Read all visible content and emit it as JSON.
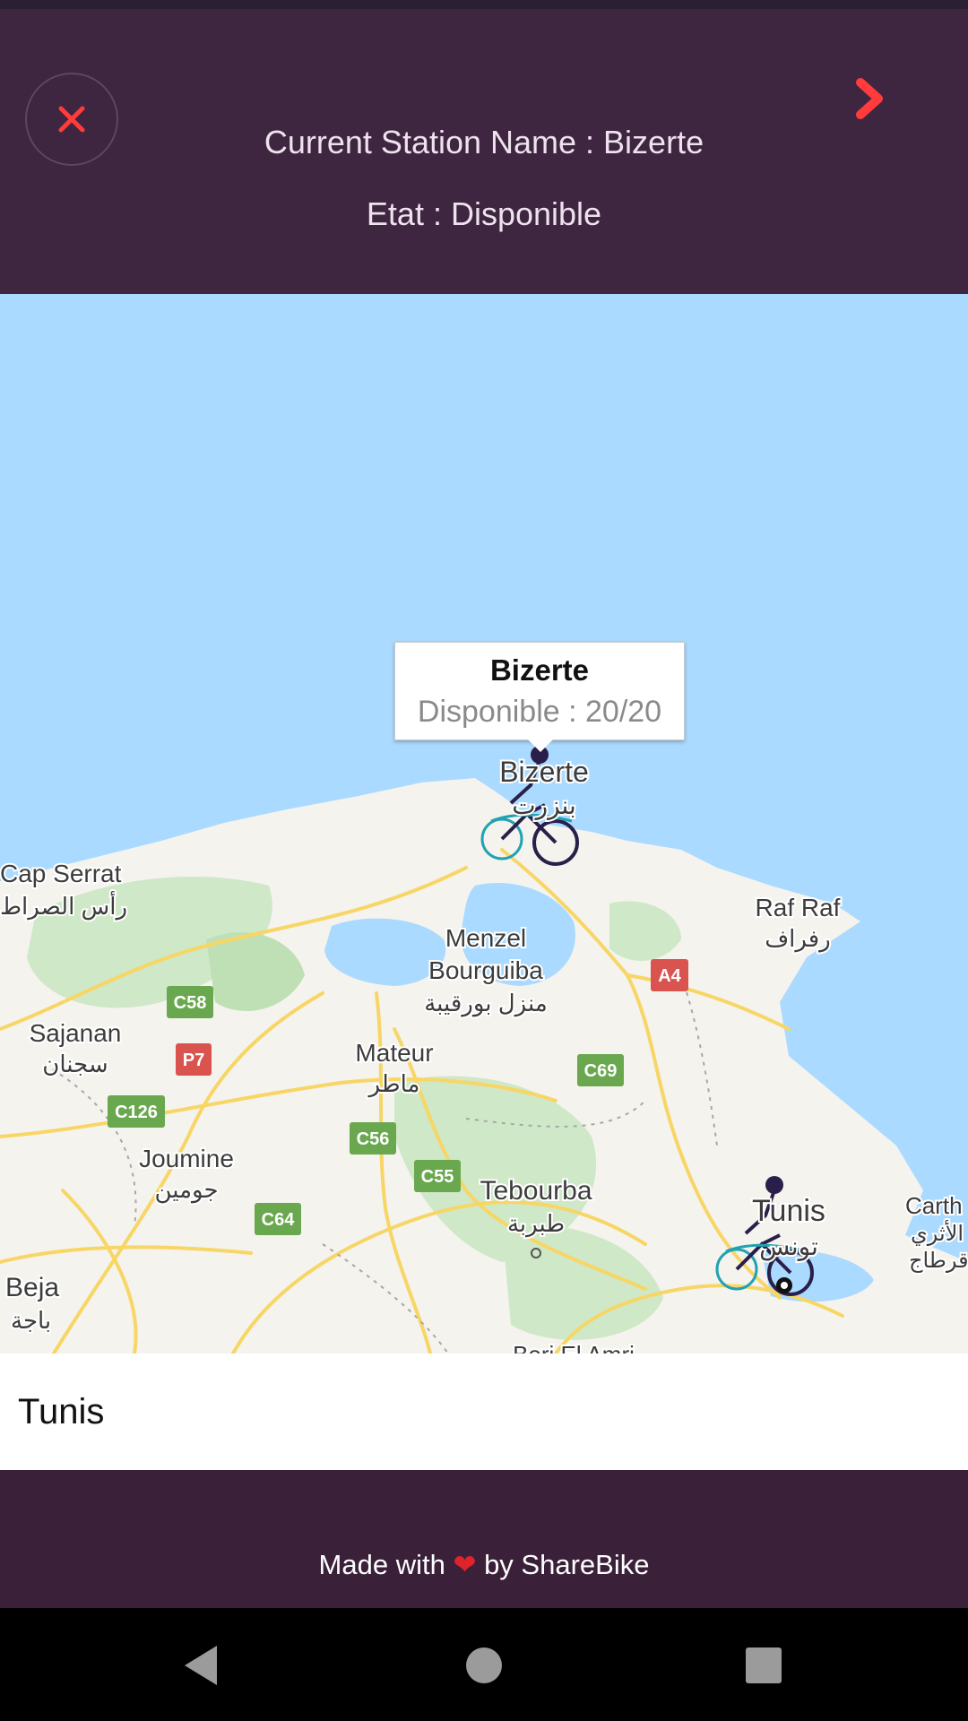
{
  "header": {
    "station_name": "Current Station Name : Bizerte",
    "state": "Etat : Disponible",
    "close_icon": "close-icon",
    "next_icon": "chevron-right-icon",
    "accent": "#ff3b3b",
    "background": "#3e2540"
  },
  "map": {
    "info_window": {
      "title": "Bizerte",
      "subtitle": "Disponible : 20/20"
    },
    "places": {
      "bizerte": "Bizerte",
      "bizerte_ar": "بنزرت",
      "cap_serrat": "Cap Serrat",
      "cap_serrat_ar": "رأس الصراط",
      "raf_raf": "Raf Raf",
      "raf_raf_ar": "رفراف",
      "menzel_1": "Menzel",
      "menzel_2": "Bourguiba",
      "menzel_ar": "منزل بورقيبة",
      "sajanan": "Sajanan",
      "sajanan_ar": "سجنان",
      "mateur": "Mateur",
      "mateur_ar": "ماطر",
      "joumine": "Joumine",
      "joumine_ar": "جومين",
      "tebourba": "Tebourba",
      "tebourba_ar": "طبربة",
      "tunis": "Tunis",
      "tunis_ar": "تونس",
      "beja": "Beja",
      "beja_ar": "باجة",
      "carthage": "Carth",
      "carthage_ar": "الأثري",
      "carthage_ar2": "قرطاج",
      "beni": "Borj El Amri"
    },
    "road_badges": {
      "c58": "C58",
      "p7": "P7",
      "c126": "C126",
      "c56": "C56",
      "c55": "C55",
      "c64": "C64",
      "c69": "C69",
      "a4": "A4"
    },
    "marker_icon": "bike-marker-icon"
  },
  "search": {
    "value": "Tunis"
  },
  "footer": {
    "made_with": "Made with",
    "heart": "❤",
    "by": "by ShareBike"
  },
  "navbar": {
    "back_icon": "back-icon",
    "home_icon": "home-icon",
    "recents_icon": "recents-icon"
  }
}
